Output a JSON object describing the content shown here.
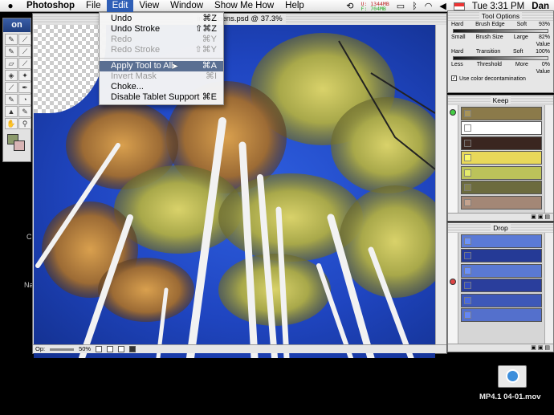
{
  "menubar": {
    "apple": "",
    "items": [
      "Photoshop",
      "File",
      "Edit",
      "View",
      "Window",
      "Show Me How",
      "Help"
    ],
    "clock": "Tue 3:31 PM",
    "user": "Dan",
    "memory": [
      "U: 1344MB",
      "F: 704MB"
    ]
  },
  "edit_menu": {
    "items": [
      {
        "label": "Undo",
        "shortcut": "⌘Z",
        "enabled": true
      },
      {
        "label": "Undo Stroke",
        "shortcut": "⇧⌘Z",
        "enabled": true
      },
      {
        "label": "Redo",
        "shortcut": "⌘Y",
        "enabled": false
      },
      {
        "label": "Redo Stroke",
        "shortcut": "⇧⌘Y",
        "enabled": false
      },
      {
        "label": "Apply Tool to All",
        "shortcut": "⌘A",
        "enabled": true,
        "highlighted": true
      },
      {
        "label": "Invert Mask",
        "shortcut": "⌘I",
        "enabled": false
      },
      {
        "label": "Choke...",
        "shortcut": "",
        "enabled": true
      },
      {
        "label": "Disable Tablet Support",
        "shortcut": "⌘E",
        "enabled": true
      }
    ]
  },
  "document": {
    "title_fragment": "ing Aspens.psd @ 37.3%",
    "status_label": "Op:",
    "zoom": "50%"
  },
  "tool_options": {
    "title": "Tool Options",
    "brush_edge": {
      "left": "Hard",
      "label": "Brush Edge",
      "right": "Soft",
      "value": "93%"
    },
    "brush_size": {
      "left": "Small",
      "label": "Brush Size",
      "right": "Large",
      "value": "82%",
      "value_label": "Value"
    },
    "transition": {
      "left": "Hard",
      "label": "Transition",
      "right": "Soft",
      "value": "100%"
    },
    "threshold": {
      "left": "Less",
      "label": "Threshold",
      "right": "More",
      "value": "0%",
      "value_label": "Value"
    },
    "decontam": "Use color decontamination"
  },
  "keep_panel": {
    "title": "Keep",
    "swatches": [
      "#8b7a4a",
      "#ffffff",
      "#3a2620",
      "#e8d85a",
      "#bcc25a",
      "#6c6b3e",
      "#a38776"
    ]
  },
  "drop_panel": {
    "title": "Drop",
    "swatches": [
      "#5b7ad6",
      "#253a96",
      "#5a79d3",
      "#2a3e9c",
      "#3d58b8",
      "#5470cc"
    ]
  },
  "desktop": {
    "labels": [
      "C",
      "Na"
    ],
    "movie_label": "MP4.1 04-01.mov"
  },
  "colors": {
    "menu_highlight": "#5a6f92",
    "menubar_active": "#2f5fb7",
    "sky": "#1f45c0"
  }
}
